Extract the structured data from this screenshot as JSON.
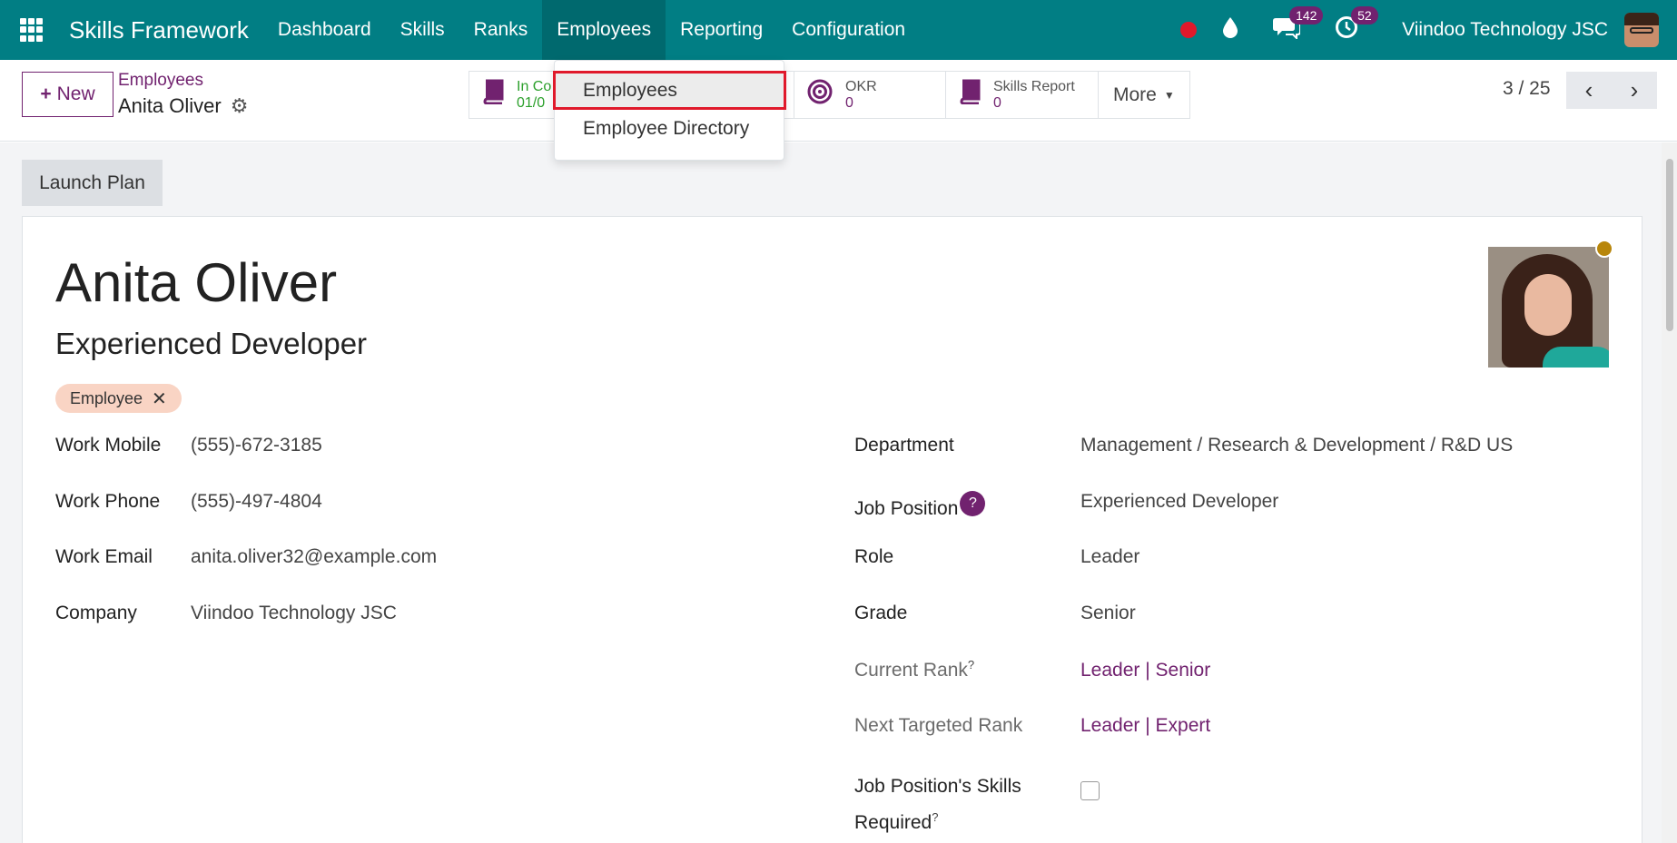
{
  "navbar": {
    "brand": "Skills Framework",
    "menu": [
      "Dashboard",
      "Skills",
      "Ranks",
      "Employees",
      "Reporting",
      "Configuration"
    ],
    "active_menu": "Employees",
    "messages_count": "142",
    "activities_count": "52",
    "company": "Viindoo Technology JSC",
    "color": "#017e84"
  },
  "control": {
    "new_label": "New",
    "breadcrumb_parent": "Employees",
    "breadcrumb_current": "Anita Oliver",
    "stats": [
      {
        "label": "In Co",
        "value": "01/0"
      },
      {
        "label": "OKR",
        "value": "0"
      },
      {
        "label": "Skills Report",
        "value": "0"
      }
    ],
    "more_label": "More",
    "pager": "3 / 25"
  },
  "dropdown": {
    "items": [
      "Employees",
      "Employee Directory"
    ],
    "highlighted": "Employees"
  },
  "form": {
    "launch_plan": "Launch Plan",
    "name": "Anita Oliver",
    "job_title": "Experienced Developer",
    "tag": "Employee",
    "left": [
      {
        "label": "Work Mobile",
        "value": "(555)-672-3185"
      },
      {
        "label": "Work Phone",
        "value": "(555)-497-4804"
      },
      {
        "label": "Work Email",
        "value": "anita.oliver32@example.com"
      },
      {
        "label": "Company",
        "value": "Viindoo Technology JSC"
      }
    ],
    "right": {
      "department_label": "Department",
      "department_value": "Management / Research & Development / R&D US",
      "job_position_label": "Job Position",
      "job_position_value": "Experienced Developer",
      "role_label": "Role",
      "role_value": "Leader",
      "grade_label": "Grade",
      "grade_value": "Senior",
      "current_rank_label": "Current Rank",
      "current_rank_value": "Leader | Senior",
      "next_rank_label": "Next Targeted Rank",
      "next_rank_value": "Leader | Expert",
      "skills_required_label_1": "Job Position's Skills",
      "skills_required_label_2": "Required"
    }
  },
  "accent_color": "#71226f"
}
